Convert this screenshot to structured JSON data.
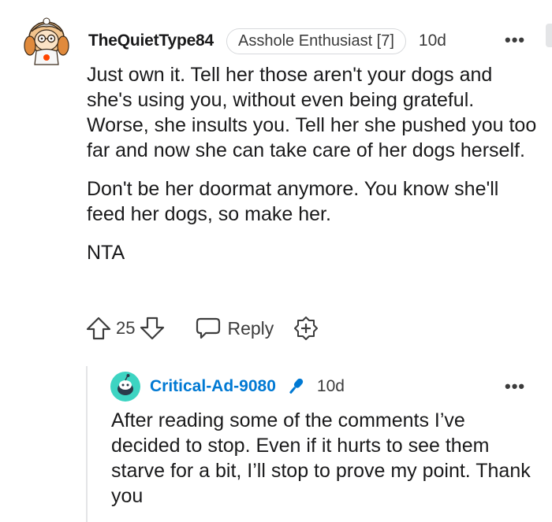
{
  "colors": {
    "username": "#1a1a1b",
    "reply_username": "#0079d3",
    "muted_text": "#3c3c3c",
    "flair_border": "#d7d9dc",
    "thread_line": "#e4e5e7"
  },
  "comment": {
    "avatar_icon": "snoo-avatar-icon",
    "username": "TheQuietType84",
    "flair": "Asshole Enthusiast [7]",
    "age": "10d",
    "more_icon": "more-options-icon",
    "paragraphs": [
      "Just own it. Tell her those aren't your dogs and she's using you, without even being grateful. Worse, she insults you. Tell her she pushed you too far and now she can take care of her dogs herself.",
      "Don't be her doormat anymore. You know she'll feed her dogs, so make her.",
      "NTA"
    ],
    "actions": {
      "upvote_icon": "upvote-arrow-icon",
      "score": "25",
      "downvote_icon": "downvote-arrow-icon",
      "reply_icon": "speech-bubble-icon",
      "reply_label": "Reply",
      "award_icon": "award-plus-icon"
    }
  },
  "reply": {
    "avatar_icon": "default-snoo-avatar-icon",
    "username": "Critical-Ad-9080",
    "op_badge_icon": "microphone-icon",
    "age": "10d",
    "more_icon": "more-options-icon",
    "text": "After reading some of the comments I’ve decided to stop. Even if it hurts to see them starve for a bit, I’ll stop to prove my point. Thank you"
  }
}
